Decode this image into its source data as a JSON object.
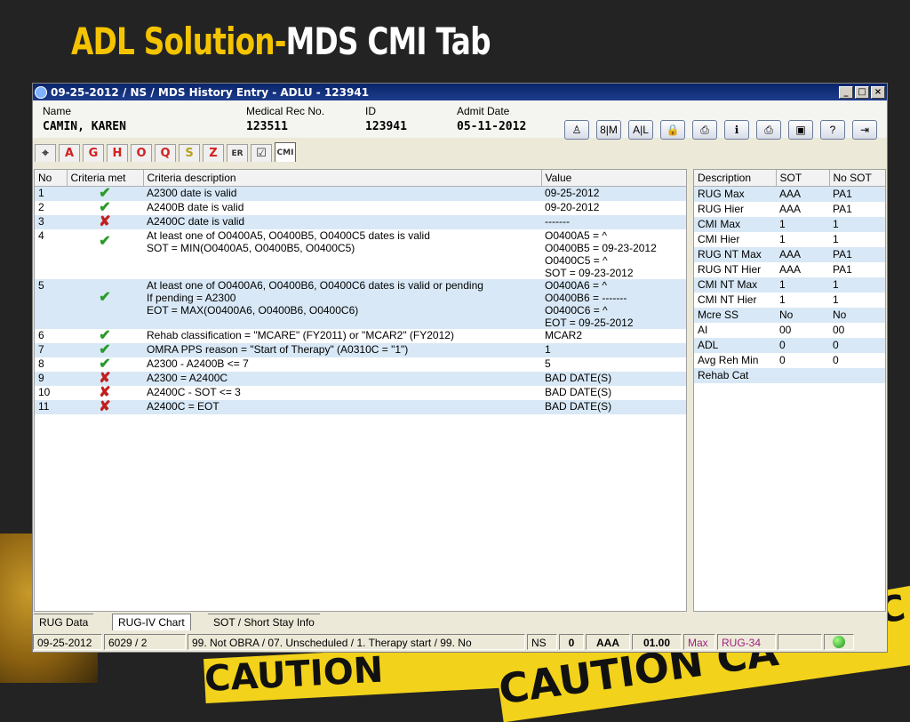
{
  "slide": {
    "title_part1": "ADL Solution-",
    "title_part2": "MDS CMI Tab"
  },
  "background": {
    "tape_text": "CAUTION",
    "tape_text_2": "CAUTION CA",
    "tape_text_3": "C"
  },
  "window": {
    "title": "09-25-2012 / NS / MDS History Entry - ADLU - 123941",
    "controls": {
      "min": "_",
      "max": "□",
      "close": "×"
    }
  },
  "patient": {
    "name_label": "Name",
    "name": "CAMIN, KAREN",
    "mrn_label": "Medical Rec No.",
    "mrn": "123511",
    "id_label": "ID",
    "id": "123941",
    "admit_label": "Admit Date",
    "admit": "05-11-2012"
  },
  "toolbar": [
    {
      "name": "person-icon",
      "glyph": "♙"
    },
    {
      "name": "sort-icon",
      "glyph": "8|M"
    },
    {
      "name": "azlist-icon",
      "glyph": "A|L"
    },
    {
      "name": "lock-icon",
      "glyph": "🔒"
    },
    {
      "name": "print-preview-icon",
      "glyph": "⎙"
    },
    {
      "name": "info-icon",
      "glyph": "ℹ"
    },
    {
      "name": "printer-icon",
      "glyph": "⎙"
    },
    {
      "name": "book-icon",
      "glyph": "▣"
    },
    {
      "name": "help-icon",
      "glyph": "?"
    },
    {
      "name": "exit-icon",
      "glyph": "⇥"
    }
  ],
  "tabs": [
    {
      "id": "tools",
      "label": "⌖",
      "color": "#333333"
    },
    {
      "id": "A",
      "label": "A",
      "color": "#d02020"
    },
    {
      "id": "G",
      "label": "G",
      "color": "#d02020"
    },
    {
      "id": "H",
      "label": "H",
      "color": "#d02020"
    },
    {
      "id": "O",
      "label": "O",
      "color": "#d02020"
    },
    {
      "id": "Q",
      "label": "Q",
      "color": "#d02020"
    },
    {
      "id": "S",
      "label": "S",
      "color": "#b8a020"
    },
    {
      "id": "Z",
      "label": "Z",
      "color": "#d02020"
    },
    {
      "id": "ER",
      "label": "ER",
      "color": "#333333"
    },
    {
      "id": "check",
      "label": "☑",
      "color": "#333333"
    },
    {
      "id": "CMI",
      "label": "CMI",
      "color": "#333333"
    }
  ],
  "criteria": {
    "headers": {
      "no": "No",
      "met": "Criteria met",
      "desc": "Criteria description",
      "value": "Value"
    },
    "rows": [
      {
        "no": "1",
        "met": "✔",
        "status": "ok",
        "desc": "A2300 date is valid",
        "value": "09-25-2012"
      },
      {
        "no": "2",
        "met": "✔",
        "status": "ok",
        "desc": "A2400B date is valid",
        "value": "09-20-2012"
      },
      {
        "no": "3",
        "met": "✘",
        "status": "bad",
        "desc": "A2400C date is valid",
        "value": "-------"
      },
      {
        "no": "4",
        "met": "✔",
        "status": "ok",
        "desc": "At least one of O0400A5, O0400B5, O0400C5 dates is valid\nSOT = MIN(O0400A5, O0400B5, O0400C5)",
        "value": "O0400A5 = ^\nO0400B5 = 09-23-2012\nO0400C5 = ^\nSOT = 09-23-2012"
      },
      {
        "no": "5",
        "met": "✔",
        "status": "ok",
        "desc": "At least one of O0400A6, O0400B6, O0400C6 dates is valid or pending\nIf pending = A2300\nEOT = MAX(O0400A6, O0400B6, O0400C6)",
        "value": "O0400A6 = ^\nO0400B6 = -------\nO0400C6 = ^\nEOT = 09-25-2012"
      },
      {
        "no": "6",
        "met": "✔",
        "status": "ok",
        "desc": "Rehab classification = \"MCARE\" (FY2011) or \"MCAR2\" (FY2012)",
        "value": "MCAR2"
      },
      {
        "no": "7",
        "met": "✔",
        "status": "ok",
        "desc": "OMRA PPS reason = \"Start of Therapy\" (A0310C = \"1\")",
        "value": "1"
      },
      {
        "no": "8",
        "met": "✔",
        "status": "ok",
        "desc": "A2300 - A2400B <= 7",
        "value": "5"
      },
      {
        "no": "9",
        "met": "✘",
        "status": "bad",
        "desc": "A2300 = A2400C",
        "value": "BAD DATE(S)"
      },
      {
        "no": "10",
        "met": "✘",
        "status": "bad",
        "desc": "A2400C - SOT <= 3",
        "value": "BAD DATE(S)"
      },
      {
        "no": "11",
        "met": "✘",
        "status": "bad",
        "desc": "A2400C = EOT",
        "value": "BAD DATE(S)"
      }
    ]
  },
  "summary": {
    "headers": {
      "desc": "Description",
      "sot": "SOT",
      "nosot": "No SOT"
    },
    "rows": [
      {
        "desc": "RUG Max",
        "sot": "AAA",
        "nosot": "PA1"
      },
      {
        "desc": "RUG Hier",
        "sot": "AAA",
        "nosot": "PA1"
      },
      {
        "desc": "CMI Max",
        "sot": "1",
        "nosot": "1"
      },
      {
        "desc": "CMI Hier",
        "sot": "1",
        "nosot": "1"
      },
      {
        "desc": "RUG NT Max",
        "sot": "AAA",
        "nosot": "PA1"
      },
      {
        "desc": "RUG NT Hier",
        "sot": "AAA",
        "nosot": "PA1"
      },
      {
        "desc": "CMI NT Max",
        "sot": "1",
        "nosot": "1"
      },
      {
        "desc": "CMI NT Hier",
        "sot": "1",
        "nosot": "1"
      },
      {
        "desc": "Mcre SS",
        "sot": "No",
        "nosot": "No"
      },
      {
        "desc": "AI",
        "sot": "00",
        "nosot": "00"
      },
      {
        "desc": "ADL",
        "sot": "0",
        "nosot": "0"
      },
      {
        "desc": "Avg Reh Min",
        "sot": "0",
        "nosot": "0"
      },
      {
        "desc": "Rehab Cat",
        "sot": "",
        "nosot": ""
      }
    ]
  },
  "bottom_tabs": [
    "RUG Data",
    "RUG-IV Chart",
    "SOT / Short Stay Info"
  ],
  "statusbar": {
    "date": "09-25-2012",
    "code": "6029 / 2",
    "desc": "99. Not OBRA / 07. Unscheduled / 1. Therapy start / 99. No",
    "ns": "NS",
    "zero": "0",
    "rug": "AAA",
    "cmi": "01.00",
    "max": "Max",
    "rugver": "RUG-34"
  }
}
